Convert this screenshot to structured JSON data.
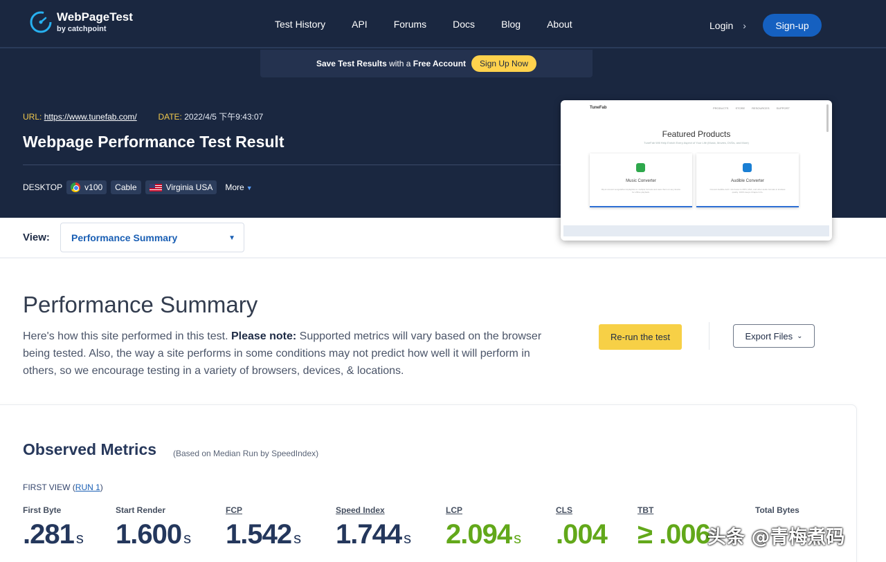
{
  "header": {
    "logo_title": "WebPageTest",
    "logo_sub": "by catchpoint",
    "nav": [
      "Test History",
      "API",
      "Forums",
      "Docs",
      "Blog",
      "About"
    ],
    "login": "Login",
    "signup": "Sign-up"
  },
  "banner": {
    "part1": "Save Test Results",
    "part2": " with a ",
    "part3": "Free Account",
    "cta": "Sign Up Now"
  },
  "test": {
    "url_label": "URL:",
    "url": "https://www.tunefab.com/",
    "date_label": "DATE:",
    "date": "2022/4/5 下午9:43:07",
    "title": "Webpage Performance Test Result",
    "device": "DESKTOP",
    "browser": "v100",
    "connection": "Cable",
    "location": "Virginia USA",
    "more": "More"
  },
  "thumbnail": {
    "brand": "TuneFab",
    "menu": [
      "PRODUCTS",
      "STORE",
      "RESOURCES",
      "SUPPORT"
    ],
    "title": "Featured Products",
    "subtitle": "TuneFab Will Help Enrich Every Aspect of Your Life (Music, Movies, DVDs, and More)",
    "cards": [
      {
        "name": "Music Converter",
        "desc": "Rip & convert songs/albums/playlists to multiple formats and save them on any device for offline playback.",
        "color": "#2ea84c"
      },
      {
        "name": "Audible Converter",
        "desc": "Convert Audible AAX / AA books to MP3, M4A, and other audio formats in lossless quality. 100% keeps Chapter Info.",
        "color": "#1a7fd4"
      }
    ]
  },
  "view": {
    "label": "View:",
    "selected": "Performance Summary"
  },
  "summary": {
    "title": "Performance Summary",
    "desc_pre": "Here's how this site performed in this test. ",
    "desc_bold": "Please note:",
    "desc_post": " Supported metrics will vary based on the browser being tested. Also, the way a site performs in some conditions may not predict how well it will perform in others, so we encourage testing in a variety of browsers, devices, & locations.",
    "rerun": "Re-run the test",
    "export": "Export Files"
  },
  "observed": {
    "title": "Observed Metrics",
    "subtitle": "(Based on Median Run by SpeedIndex)",
    "first_view": "FIRST VIEW (",
    "run": "RUN 1",
    "close_paren": ")",
    "metrics": [
      {
        "name": "First Byte",
        "value": ".281",
        "unit": "s"
      },
      {
        "name": "Start Render",
        "value": "1.600",
        "unit": "s"
      },
      {
        "name": "FCP",
        "value": "1.542",
        "unit": "s"
      },
      {
        "name": "Speed Index",
        "value": "1.744",
        "unit": "s"
      },
      {
        "name": "LCP",
        "value": "2.094",
        "unit": "s"
      },
      {
        "name": "CLS",
        "value": ".004",
        "unit": ""
      },
      {
        "name": "TBT",
        "value": "≥ .006",
        "unit": ""
      },
      {
        "name": "Total Bytes",
        "value": "",
        "unit": ""
      }
    ]
  },
  "watermark": "头条 @青梅煮码"
}
